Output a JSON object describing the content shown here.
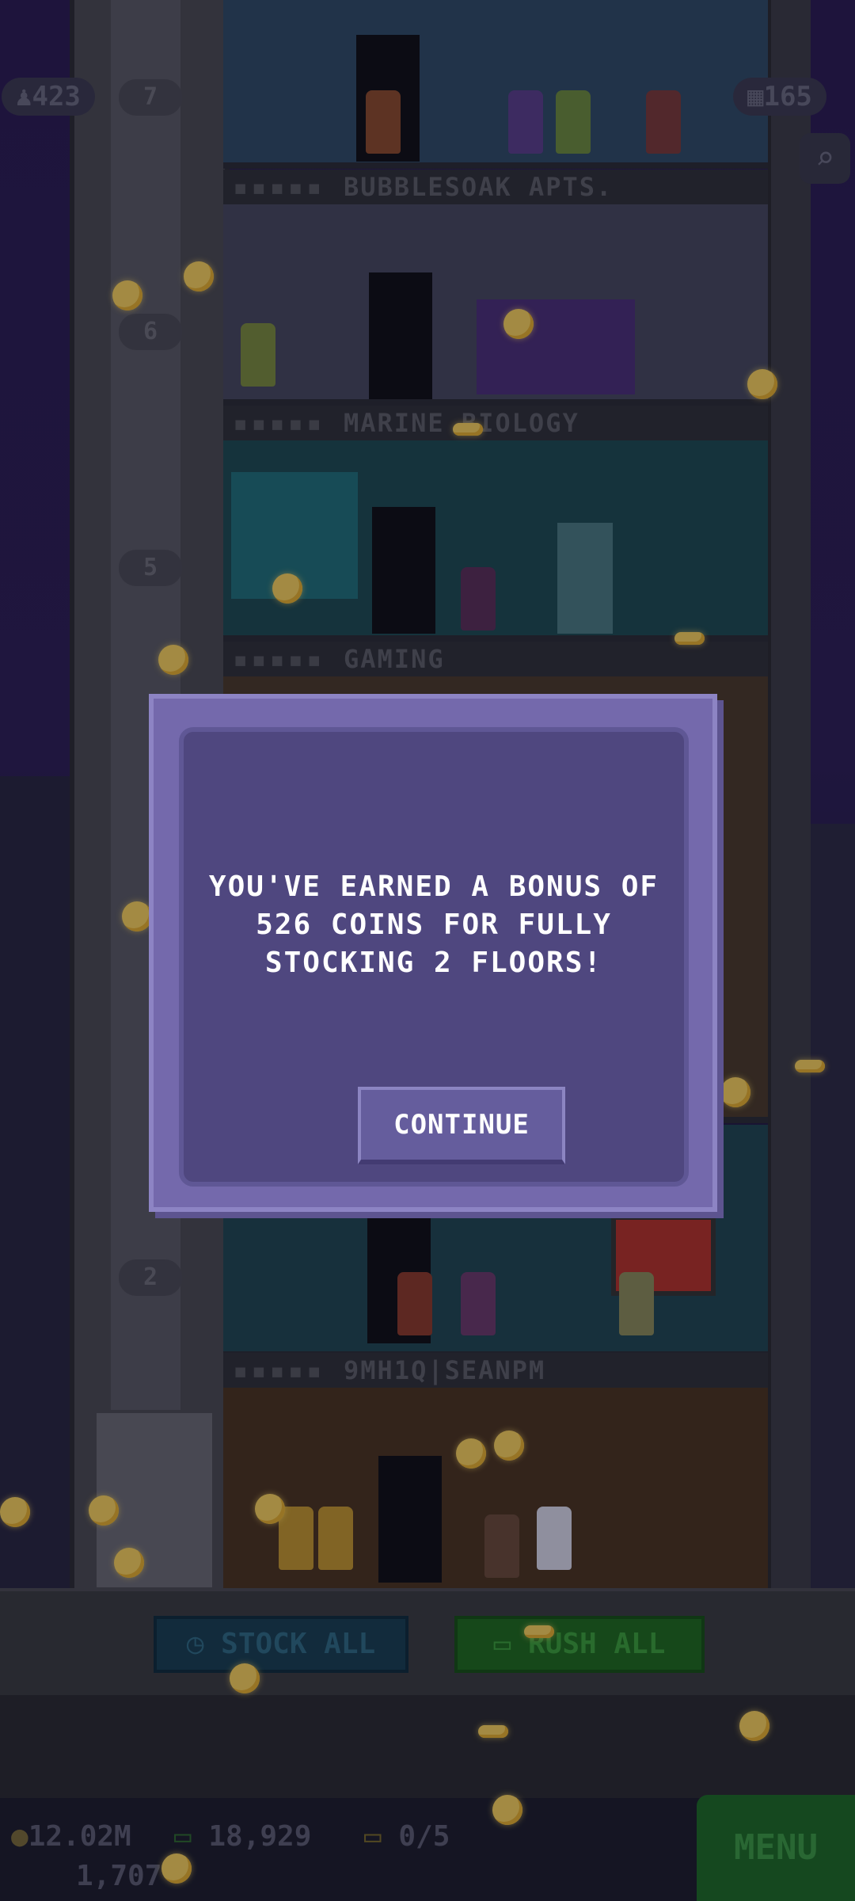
{
  "header": {
    "population": "423",
    "floor_count": "165",
    "search_icon": "magnifier-icon"
  },
  "floors": [
    {
      "name": "BUBBLESOAK APTS.",
      "number": "7"
    },
    {
      "name": "MARINE BIOLOGY",
      "number": "6"
    },
    {
      "name": "GAMING",
      "number": "5"
    },
    {
      "name": "9MH1Q|SEANPM",
      "number": "2"
    }
  ],
  "dialog": {
    "message": "YOU'VE EARNED A BONUS OF 526 COINS FOR FULLY STOCKING 2 FLOORS!",
    "line1": "YOU'VE EARNED A BONUS OF",
    "line2": "526 COINS FOR FULLY",
    "line3": "STOCKING 2 FLOORS!",
    "button": "CONTINUE"
  },
  "actions": {
    "stock_all": "STOCK ALL",
    "rush_all": "RUSH ALL"
  },
  "status": {
    "coins": "12.02M",
    "bux": "18,929",
    "tickets": "0/5",
    "population_total": "1,707",
    "menu": "MENU"
  }
}
